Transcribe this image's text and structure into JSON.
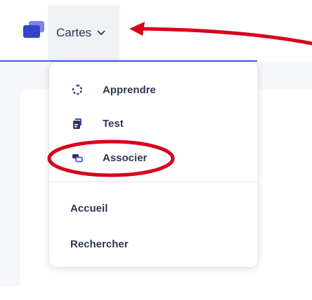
{
  "header": {
    "menu_button_label": "Cartes",
    "accent_color": "#4255ff",
    "logo_icon": "stacked-cards-icon",
    "chevron_icon": "chevron-down-icon"
  },
  "dropdown": {
    "study_modes": [
      {
        "label": "Apprendre",
        "icon": "learn-progress-icon"
      },
      {
        "label": "Test",
        "icon": "test-document-icon"
      },
      {
        "label": "Associer",
        "icon": "match-icon"
      }
    ],
    "links": [
      {
        "label": "Accueil"
      },
      {
        "label": "Rechercher"
      }
    ]
  },
  "annotation": {
    "color": "#d6001c",
    "arrow_target": "menu_button",
    "circled_item": "Associer"
  }
}
